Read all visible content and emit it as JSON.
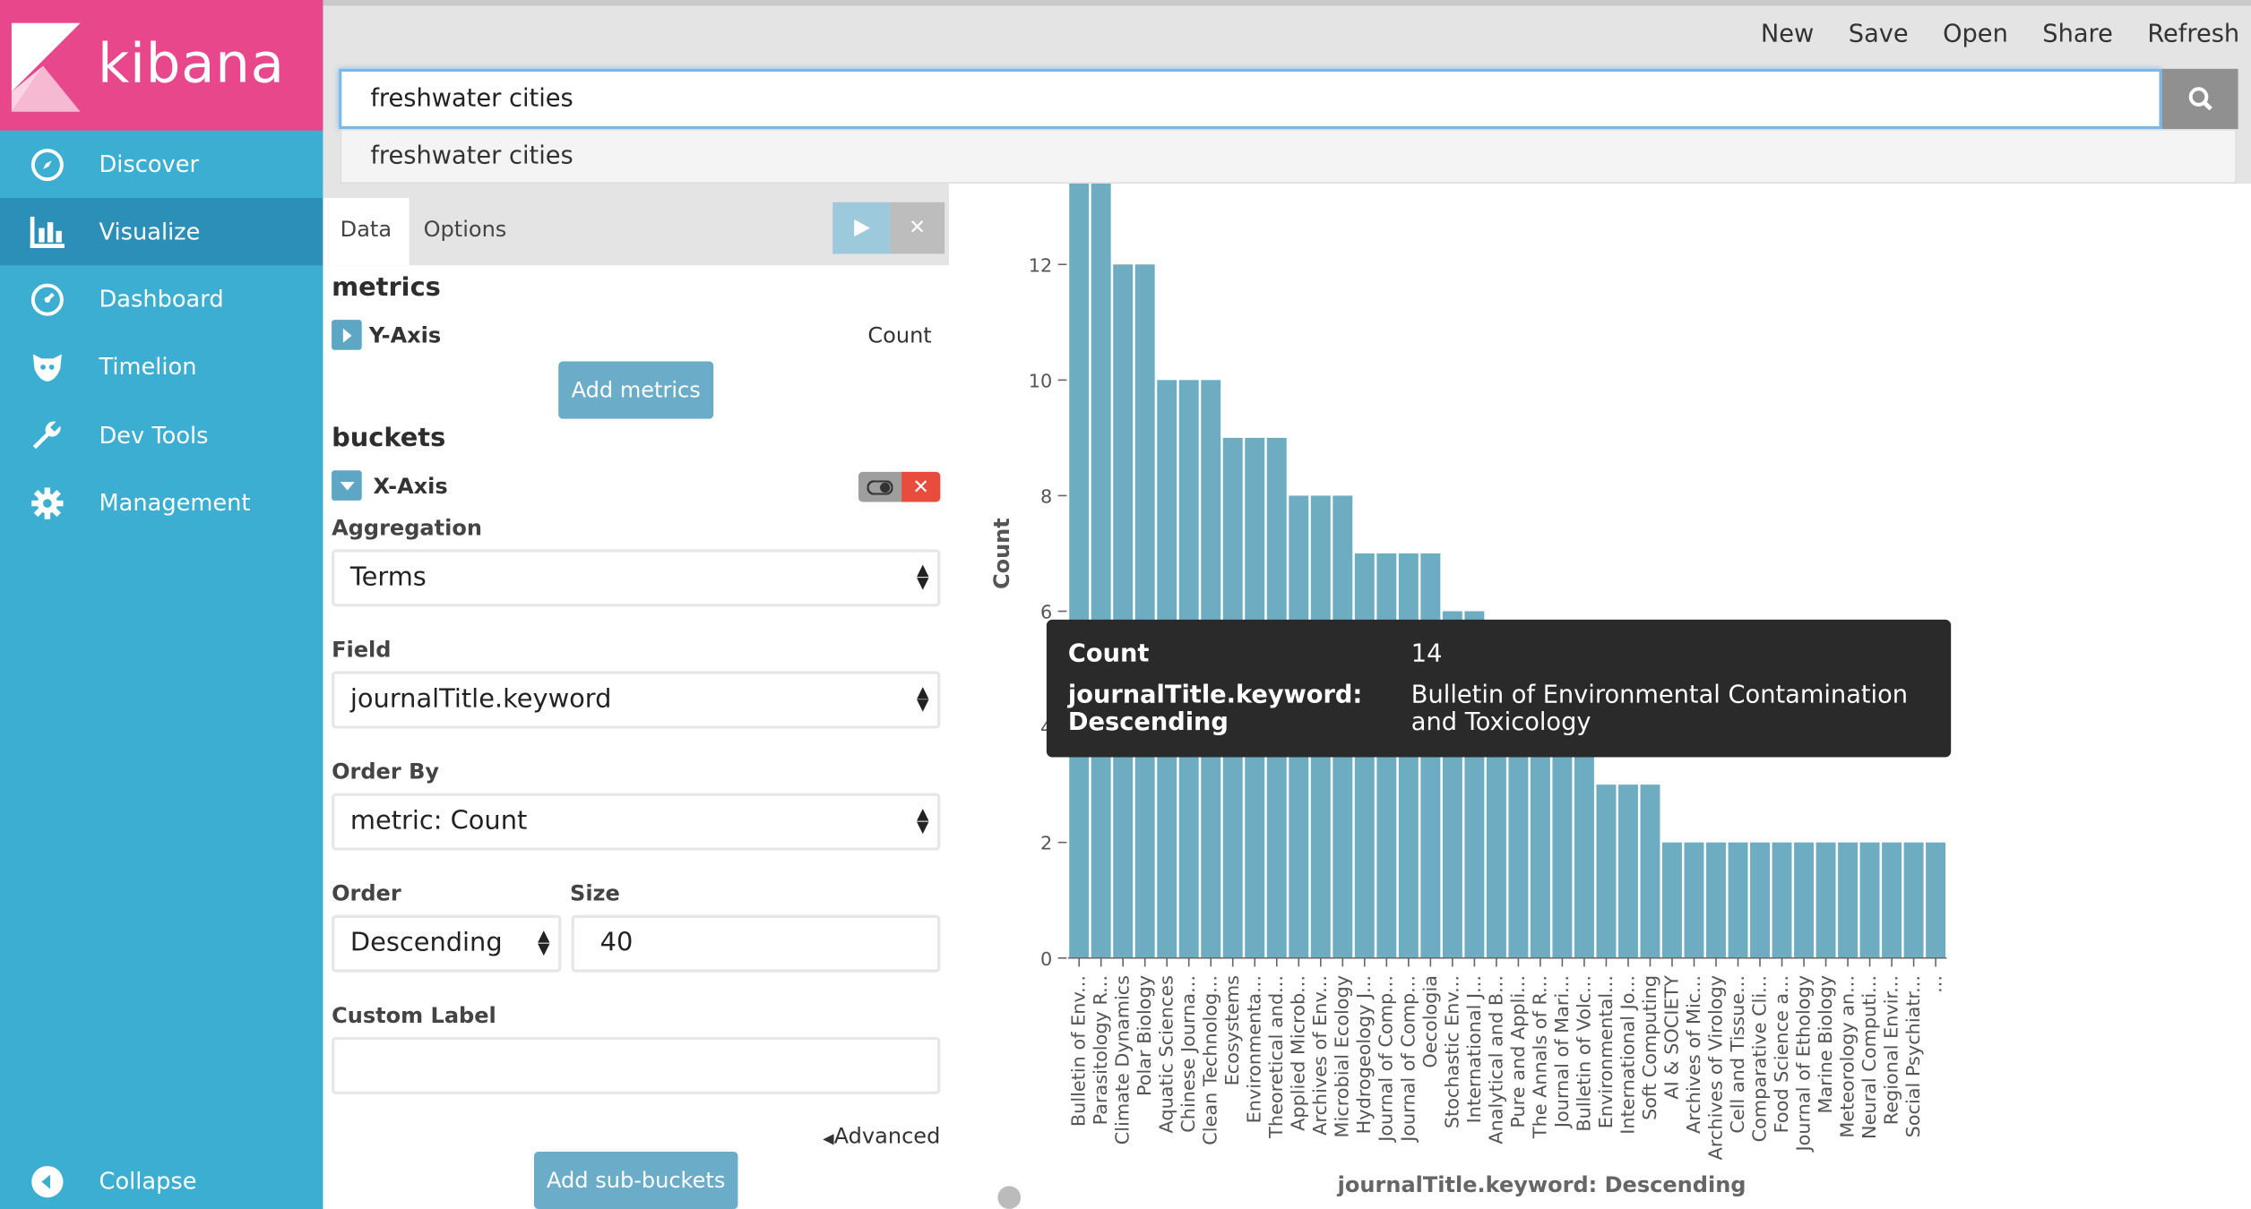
{
  "app": {
    "name": "kibana"
  },
  "sidebar": {
    "items": [
      {
        "label": "Discover",
        "icon": "compass-icon"
      },
      {
        "label": "Visualize",
        "icon": "bar-chart-icon"
      },
      {
        "label": "Dashboard",
        "icon": "dashboard-icon"
      },
      {
        "label": "Timelion",
        "icon": "timelion-icon"
      },
      {
        "label": "Dev Tools",
        "icon": "wrench-icon"
      },
      {
        "label": "Management",
        "icon": "gear-icon"
      }
    ],
    "collapse_label": "Collapse",
    "active": "Visualize"
  },
  "topbar": {
    "menu": [
      "New",
      "Save",
      "Open",
      "Share",
      "Refresh"
    ],
    "search_value": "freshwater cities",
    "suggestion": "freshwater cities"
  },
  "editor": {
    "tabs": [
      "Data",
      "Options"
    ],
    "metrics_title": "metrics",
    "y_axis_label": "Y-Axis",
    "y_axis_value": "Count",
    "add_metrics": "Add metrics",
    "buckets_title": "buckets",
    "x_axis_label": "X-Axis",
    "aggregation_label": "Aggregation",
    "aggregation_value": "Terms",
    "field_label": "Field",
    "field_value": "journalTitle.keyword",
    "order_by_label": "Order By",
    "order_by_value": "metric: Count",
    "order_label": "Order",
    "order_value": "Descending",
    "size_label": "Size",
    "size_value": "40",
    "custom_label_label": "Custom Label",
    "custom_label_value": "",
    "advanced": "Advanced",
    "add_sub_buckets": "Add sub-buckets"
  },
  "tooltip": {
    "count_key": "Count",
    "count_value": "14",
    "field_key": "journalTitle.keyword: Descending",
    "field_value": "Bulletin of Environmental Contamination and Toxicology"
  },
  "colors": {
    "bar": "#6eadc1",
    "sidebar": "#3caed2",
    "logo": "#e8488b",
    "active_nav": "#2b8fb8"
  },
  "chart_data": {
    "type": "bar",
    "ylabel": "Count",
    "xlabel": "journalTitle.keyword: Descending",
    "ylim": [
      0,
      12
    ],
    "yticks": [
      0,
      2,
      4,
      6,
      8,
      10,
      12
    ],
    "categories": [
      "Bulletin of Env...",
      "Parasitology R...",
      "Climate Dynamics",
      "Polar Biology",
      "Aquatic Sciences",
      "Chinese Journa...",
      "Clean Technolog...",
      "Ecosystems",
      "Environmenta...",
      "Theoretical and...",
      "Applied Microb...",
      "Archives of Env...",
      "Microbial Ecology",
      "Hydrogeology J...",
      "Journal of Comp...",
      "Journal of Comp...",
      "Oecologia",
      "Stochastic Env...",
      "International J...",
      "Analytical and B...",
      "Pure and Appli...",
      "The Annals of R...",
      "Journal of Mari...",
      "Bulletin of Volc...",
      "Environmental...",
      "International Jo...",
      "Soft Computing",
      "AI & SOCIETY",
      "Archives of Mic...",
      "Archives of Virology",
      "Cell and Tissue...",
      "Comparative Cli...",
      "Food Science a...",
      "Journal of Ethology",
      "Marine Biology",
      "Meteorology an...",
      "Neural Computi...",
      "Regional Envir...",
      "Social Psychiatr...",
      "..."
    ],
    "values": [
      14,
      14,
      12,
      12,
      10,
      10,
      10,
      9,
      9,
      9,
      8,
      8,
      8,
      7,
      7,
      7,
      7,
      6,
      6,
      5,
      5,
      5,
      4,
      4,
      3,
      3,
      3,
      2,
      2,
      2,
      2,
      2,
      2,
      2,
      2,
      2,
      2,
      2,
      2,
      2
    ]
  }
}
